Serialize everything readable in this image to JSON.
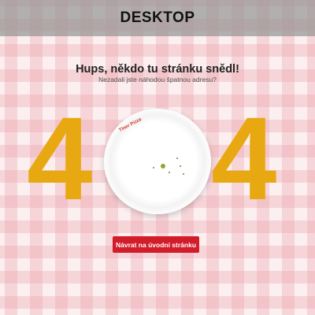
{
  "topbar": {
    "title": "DESKTOP"
  },
  "error": {
    "heading": "Hups, někdo tu stránku snědl!",
    "subheading": "Nezadali jste náhodou špatnou adresu?",
    "digit_left": "4",
    "digit_right": "4"
  },
  "plate": {
    "logo_text": "Tiner Pizza"
  },
  "actions": {
    "home_button_label": "Návrat na úvodní stránku"
  },
  "colors": {
    "digit": "#e8a812",
    "button": "#d21c2a",
    "topbar": "#969696"
  }
}
